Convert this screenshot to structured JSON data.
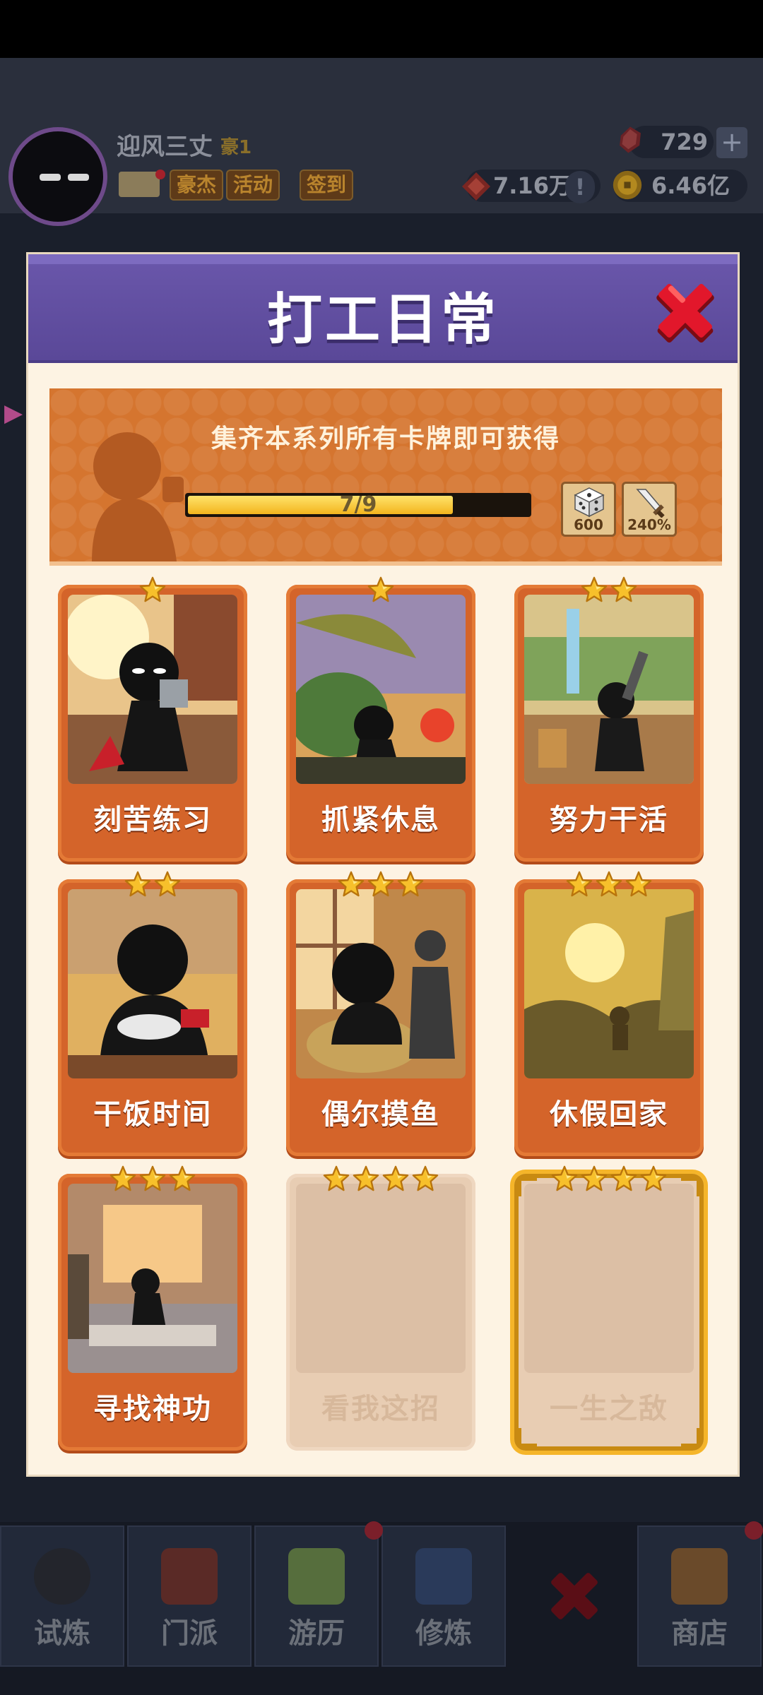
{
  "header": {
    "player_name": "迎风三丈",
    "player_rank": "豪1",
    "tags": [
      "豪杰",
      "活动",
      "签到"
    ],
    "gems": "729",
    "power": "7.16万",
    "coins": "6.46亿",
    "plus": "+",
    "power_hint": "!"
  },
  "modal": {
    "title": "打工日常",
    "banner_text": "集齐本系列所有卡牌即可获得",
    "progress": {
      "current": 7,
      "total": 9,
      "label": "7/9",
      "fraction": 0.778
    },
    "rewards": [
      {
        "icon": "dice-icon",
        "label": "600"
      },
      {
        "icon": "sword-icon",
        "label": "240%"
      }
    ],
    "cards": [
      {
        "name": "刻苦练习",
        "stars": 1,
        "owned": true,
        "scene": "training"
      },
      {
        "name": "抓紧休息",
        "stars": 1,
        "owned": true,
        "scene": "rest"
      },
      {
        "name": "努力干活",
        "stars": 2,
        "owned": true,
        "scene": "work"
      },
      {
        "name": "干饭时间",
        "stars": 2,
        "owned": true,
        "scene": "meal"
      },
      {
        "name": "偶尔摸鱼",
        "stars": 3,
        "owned": true,
        "scene": "slack"
      },
      {
        "name": "休假回家",
        "stars": 3,
        "owned": true,
        "scene": "home"
      },
      {
        "name": "寻找神功",
        "stars": 3,
        "owned": true,
        "scene": "search"
      },
      {
        "name": "看我这招",
        "stars": 4,
        "owned": false,
        "scene": "locked"
      },
      {
        "name": "一生之敌",
        "stars": 4,
        "owned": false,
        "scene": "locked-gold"
      }
    ]
  },
  "bottom_nav": [
    {
      "label": "试炼",
      "icon": "ninja-icon"
    },
    {
      "label": "门派",
      "icon": "temple-icon"
    },
    {
      "label": "游历",
      "icon": "cloud-mountain-icon"
    },
    {
      "label": "修炼",
      "icon": "book-icon"
    },
    {
      "label": "",
      "icon": "close-icon"
    },
    {
      "label": "商店",
      "icon": "shop-icon"
    }
  ],
  "colors": {
    "modal_header": "#6a57ab",
    "banner": "#d5752f",
    "card_owned": "#d4642a",
    "progress_fill": "#f3b51e",
    "close_red": "#e2172b",
    "star_gold": "#f7c02b"
  }
}
